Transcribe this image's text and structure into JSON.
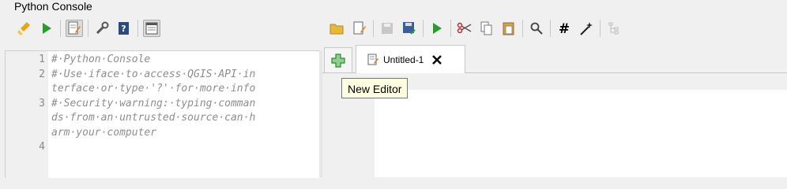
{
  "window": {
    "title": "Python Console"
  },
  "left_toolbar": {
    "buttons": [
      {
        "name": "clear-console-icon"
      },
      {
        "name": "run-command-icon"
      },
      {
        "name": "show-editor-icon",
        "pressed": true
      },
      {
        "name": "options-icon"
      },
      {
        "name": "help-icon"
      },
      {
        "name": "dock-console-icon",
        "pressed": true
      }
    ]
  },
  "right_toolbar": {
    "buttons": [
      "open-script-icon",
      "open-in-external-editor-icon",
      "save-icon",
      "save-as-icon",
      "run-script-icon",
      "cut-icon",
      "copy-icon",
      "paste-icon",
      "find-icon",
      "comment-icon",
      "uncomment-icon",
      "object-inspector-icon"
    ]
  },
  "console": {
    "line_numbers": [
      "1",
      "2",
      "3",
      "4"
    ],
    "lines": [
      "#·Python·Console",
      "#·Use·iface·to·access·QGIS·API·in",
      "terface·or·type·'?'·for·more·info",
      "#·Security·warning:·typing·comman",
      "ds·from·an·untrusted·source·can·h",
      "arm·your·computer"
    ]
  },
  "editor": {
    "tabs": [
      {
        "label": "Untitled-1"
      }
    ],
    "tooltip": "New Editor"
  },
  "colors": {
    "accent_green": "#2e9a2e",
    "comment_gray": "#8e8e8e",
    "tooltip_bg": "#ffffe1"
  }
}
